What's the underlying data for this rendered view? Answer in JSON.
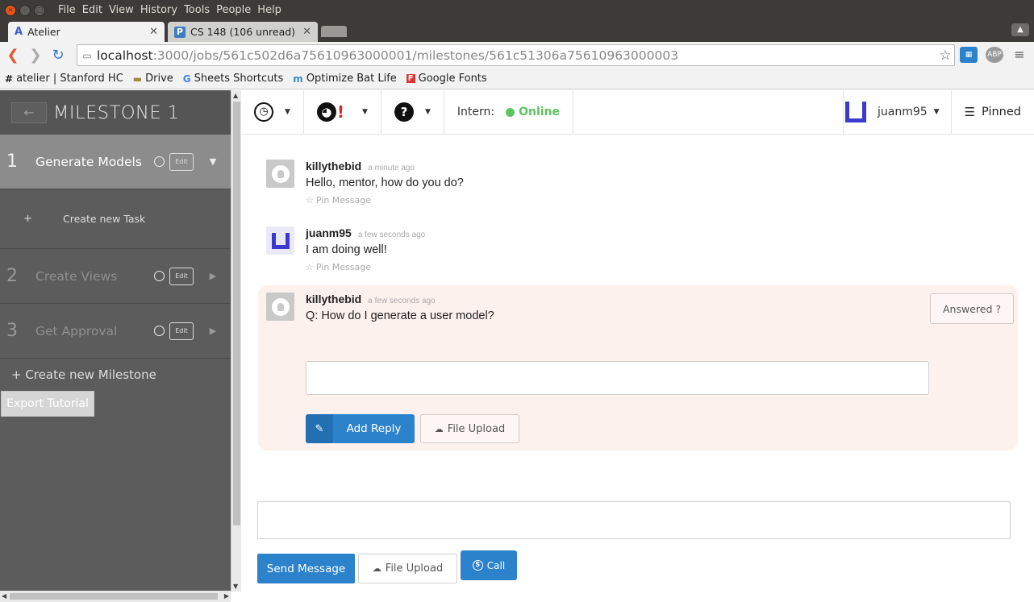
{
  "os_menu": {
    "items": [
      "File",
      "Edit",
      "View",
      "History",
      "Tools",
      "People",
      "Help"
    ]
  },
  "tabs": [
    {
      "favicon": "A",
      "title": "Atelier"
    },
    {
      "favicon": "P",
      "title": "CS 148 (106 unread)"
    }
  ],
  "address_bar": {
    "url_host": "localhost",
    "url_rest": ":3000/jobs/561c502d6a75610963000001/milestones/561c51306a75610963000003",
    "ext_badge": "ABP"
  },
  "bookmarks": [
    {
      "icon": "#",
      "label": "atelier | Stanford HC"
    },
    {
      "icon": "folder-icon",
      "label": "Drive"
    },
    {
      "icon": "G",
      "label": "Sheets Shortcuts"
    },
    {
      "icon": "m",
      "label": "Optimize Bat Life"
    },
    {
      "icon": "F",
      "label": "Google Fonts"
    }
  ],
  "sidebar": {
    "back_label": "←",
    "title": "MILESTONE 1",
    "milestones": [
      {
        "num": "1",
        "name": "Generate Models",
        "edit": "Edit",
        "caret": "▼"
      },
      {
        "num": "2",
        "name": "Create Views",
        "edit": "Edit",
        "caret": "▶"
      },
      {
        "num": "3",
        "name": "Get Approval",
        "edit": "Edit",
        "caret": "▶"
      }
    ],
    "task_plus": "+",
    "task_label": "Create new Task",
    "new_milestone": "+ Create new Milestone",
    "export_label": "Export Tutorial"
  },
  "header": {
    "intern_label": "Intern:",
    "status": "Online",
    "username": "juanm95",
    "pinned": "Pinned",
    "alert_mark": "!"
  },
  "messages": [
    {
      "author": "killythebid",
      "time": "a minute ago",
      "text": "Hello, mentor, how do you do?",
      "pin": "Pin Message"
    },
    {
      "author": "juanm95",
      "time": "a few seconds ago",
      "text": "I am doing well!",
      "pin": "Pin Message"
    },
    {
      "author": "killythebid",
      "time": "a few seconds ago",
      "text": "Q: How do I generate a user model?"
    }
  ],
  "question": {
    "answered_label": "Answered ?",
    "add_reply_label": "Add Reply",
    "file_upload_label": "File Upload"
  },
  "composer": {
    "send_label": "Send Message",
    "file_upload_label": "File Upload",
    "call_label": "Call"
  },
  "colors": {
    "accent": "#2d82cc",
    "online": "#5dc55f",
    "question_bg": "#fdf1ee",
    "sidebar_bg": "#5c5c5c",
    "avatar_blue": "#3a3acf"
  }
}
